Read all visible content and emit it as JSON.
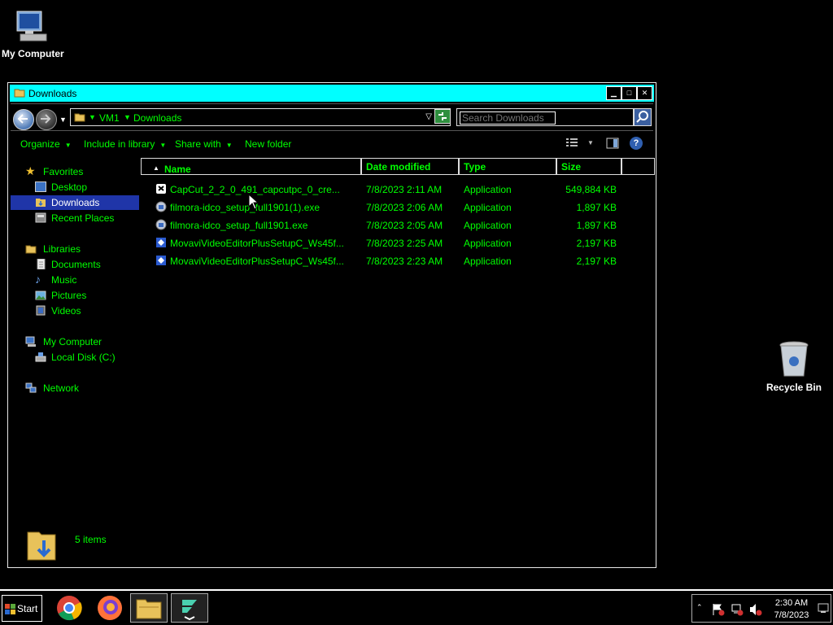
{
  "desktop": {
    "icons": [
      {
        "label": "My Computer",
        "icon": "computer-icon"
      },
      {
        "label": "Recycle Bin",
        "icon": "recycle-bin-icon"
      }
    ]
  },
  "window": {
    "title": "Downloads",
    "address": {
      "crumbs": [
        "VM1",
        "Downloads"
      ]
    },
    "search_placeholder": "Search Downloads",
    "toolbar": {
      "organize": "Organize",
      "include_in_library": "Include in library",
      "share_with": "Share with",
      "new_folder": "New folder"
    },
    "nav": {
      "favorites": "Favorites",
      "desktop": "Desktop",
      "downloads": "Downloads",
      "recent_places": "Recent Places",
      "libraries": "Libraries",
      "documents": "Documents",
      "music": "Music",
      "pictures": "Pictures",
      "videos": "Videos",
      "my_computer": "My Computer",
      "local_disk": "Local Disk (C:)",
      "network": "Network"
    },
    "columns": {
      "name": "Name",
      "date": "Date modified",
      "type": "Type",
      "size": "Size"
    },
    "files": [
      {
        "name": "CapCut_2_2_0_491_capcutpc_0_cre...",
        "date": "7/8/2023 2:11 AM",
        "type": "Application",
        "size": "549,884 KB",
        "icon": "capcut-icon"
      },
      {
        "name": "filmora-idco_setup_full1901(1).exe",
        "date": "7/8/2023 2:06 AM",
        "type": "Application",
        "size": "1,897 KB",
        "icon": "installer-icon"
      },
      {
        "name": "filmora-idco_setup_full1901.exe",
        "date": "7/8/2023 2:05 AM",
        "type": "Application",
        "size": "1,897 KB",
        "icon": "installer-icon"
      },
      {
        "name": "MovaviVideoEditorPlusSetupC_Ws45f...",
        "date": "7/8/2023 2:25 AM",
        "type": "Application",
        "size": "2,197 KB",
        "icon": "movavi-icon"
      },
      {
        "name": "MovaviVideoEditorPlusSetupC_Ws45f...",
        "date": "7/8/2023 2:23 AM",
        "type": "Application",
        "size": "2,197 KB",
        "icon": "movavi-icon"
      }
    ],
    "status": "5 items"
  },
  "taskbar": {
    "start": "Start",
    "clock_time": "2:30 AM",
    "clock_date": "7/8/2023"
  },
  "colors": {
    "accent_text": "#00ff00",
    "titlebar": "#00ffff",
    "selection": "#1f35a8"
  }
}
